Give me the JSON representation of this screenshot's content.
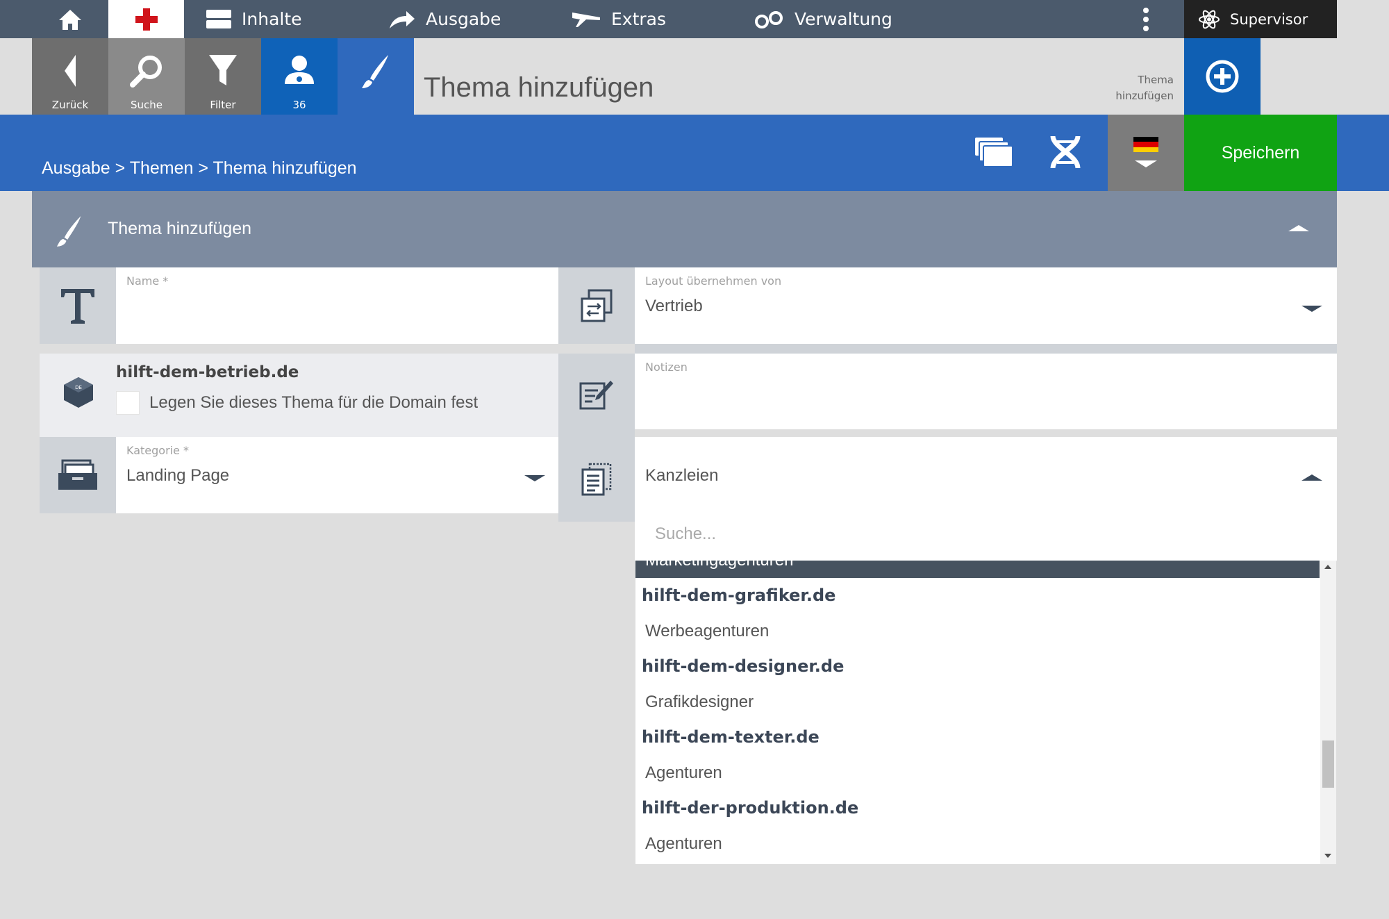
{
  "topnav": {
    "items": [
      {
        "label": ""
      },
      {
        "label": ""
      },
      {
        "label": "Inhalte"
      },
      {
        "label": "Ausgabe"
      },
      {
        "label": "Extras"
      },
      {
        "label": "Verwaltung"
      }
    ],
    "user": "Supervisor"
  },
  "toolbar": {
    "back_label": "Zurück",
    "search_label": "Suche",
    "filter_label": "Filter",
    "user_count": "36",
    "page_title": "Thema hinzufügen",
    "action_label_line1": "Thema",
    "action_label_line2": "hinzufügen"
  },
  "breadcrumb": "Ausgabe > Themen > Thema hinzufügen",
  "save_label": "Speichern",
  "section_title": "Thema hinzufügen",
  "form": {
    "name_label": "Name *",
    "name_value": "",
    "layout_label": "Layout übernehmen von",
    "layout_value": "Vertrieb",
    "domain": "hilft-dem-betrieb.de",
    "domain_checkbox_label": "Legen Sie dieses Thema für die Domain fest",
    "notes_label": "Notizen",
    "category_label": "Kategorie *",
    "category_value": "Landing Page",
    "kanzleien_value": "Kanzleien",
    "search_placeholder": "Suche..."
  },
  "dropdown_items": [
    {
      "text": "Marketingagenturen",
      "type": "cat",
      "selected": true
    },
    {
      "text": "hilft-dem-grafiker.de",
      "type": "domain"
    },
    {
      "text": "Werbeagenturen",
      "type": "cat"
    },
    {
      "text": "hilft-dem-designer.de",
      "type": "domain"
    },
    {
      "text": "Grafikdesigner",
      "type": "cat"
    },
    {
      "text": "hilft-dem-texter.de",
      "type": "domain"
    },
    {
      "text": "Agenturen",
      "type": "cat"
    },
    {
      "text": "hilft-der-produktion.de",
      "type": "domain"
    },
    {
      "text": "Agenturen",
      "type": "cat"
    }
  ],
  "colors": {
    "topnav": "#4b5a6c",
    "primary_blue": "#2f69bd",
    "save_green": "#10a313",
    "section_header": "#7d8ba0",
    "accent_red": "#d0141b"
  }
}
